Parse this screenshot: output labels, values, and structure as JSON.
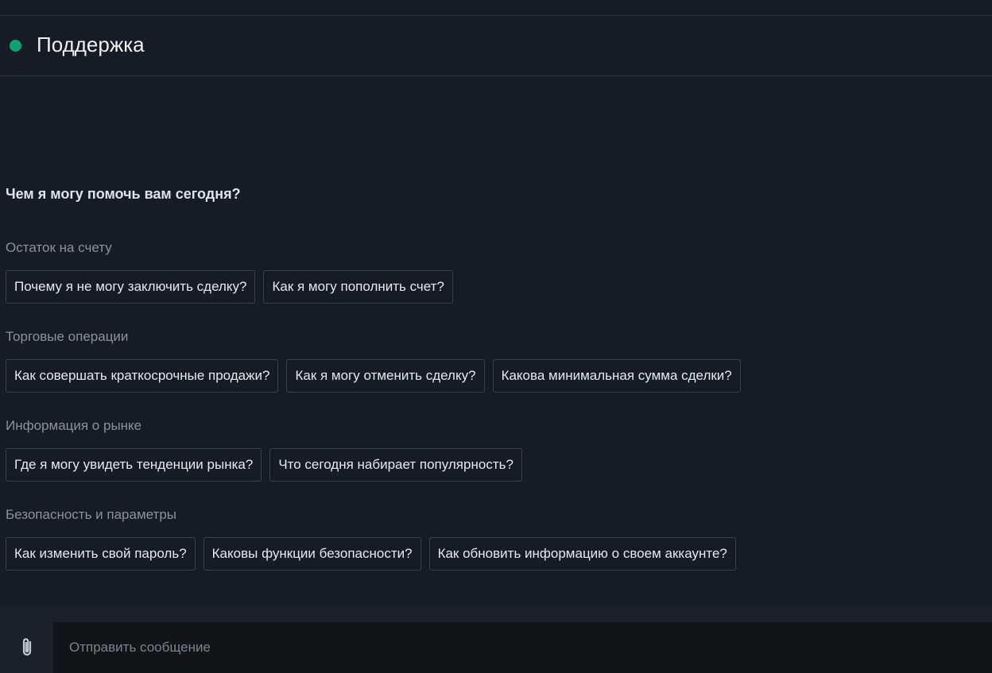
{
  "header": {
    "title": "Поддержка",
    "status_color": "#13a06f"
  },
  "greeting": "Чем я могу помочь вам сегодня?",
  "sections": [
    {
      "title": "Остаток на счету",
      "questions": [
        "Почему я не могу заключить сделку?",
        "Как я могу пополнить счет?"
      ]
    },
    {
      "title": "Торговые операции",
      "questions": [
        "Как совершать краткосрочные продажи?",
        "Как я могу отменить сделку?",
        "Какова минимальная сумма сделки?"
      ]
    },
    {
      "title": "Информация о рынке",
      "questions": [
        "Где я могу увидеть тенденции рынка?",
        "Что сегодня набирает популярность?"
      ]
    },
    {
      "title": "Безопасность и параметры",
      "questions": [
        "Как изменить свой пароль?",
        "Каковы функции безопасности?",
        "Как обновить информацию о своем аккаунте?"
      ]
    }
  ],
  "composer": {
    "placeholder": "Отправить сообщение",
    "attach_icon": "paperclip-icon"
  }
}
